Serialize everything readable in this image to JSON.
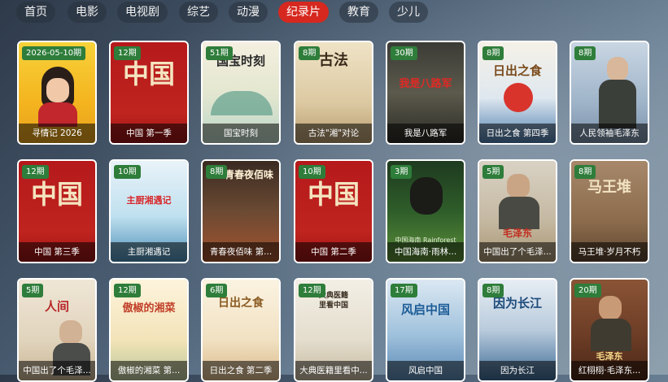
{
  "nav": {
    "tabs": [
      {
        "label": "首页"
      },
      {
        "label": "电影"
      },
      {
        "label": "电视剧"
      },
      {
        "label": "综艺"
      },
      {
        "label": "动漫"
      },
      {
        "label": "纪录片"
      },
      {
        "label": "教育"
      },
      {
        "label": "少儿"
      }
    ],
    "active_tab": "纪录片",
    "active_color": "#d6281f"
  },
  "cards": [
    {
      "badge": "2026-05-10期",
      "title": "寻情记 2026"
    },
    {
      "badge": "12期",
      "title": "中国 第一季",
      "art": "中国"
    },
    {
      "badge": "51期",
      "title": "国宝时刻",
      "art": "国宝时刻"
    },
    {
      "badge": "8期",
      "title": "古法\"湘\"对论",
      "art": "古法"
    },
    {
      "badge": "30期",
      "title": "我是八路军",
      "art": "我是八路军"
    },
    {
      "badge": "8期",
      "title": "日出之食 第四季",
      "art": "日出之食"
    },
    {
      "badge": "8期",
      "title": "人民领袖毛泽东"
    },
    {
      "badge": "12期",
      "title": "中国 第三季",
      "art": "中国"
    },
    {
      "badge": "10期",
      "title": "主厨湘遇记",
      "art": "主厨湘遇记"
    },
    {
      "badge": "8期",
      "title": "青春夜佰味 第...",
      "art": "青春夜佰味"
    },
    {
      "badge": "10期",
      "title": "中国 第二季",
      "art": "中国"
    },
    {
      "badge": "3期",
      "title": "中国海南·雨林...",
      "art": "中国海南 Rainforest"
    },
    {
      "badge": "5期",
      "title": "中国出了个毛泽...",
      "art": "毛泽东"
    },
    {
      "badge": "8期",
      "title": "马王堆·岁月不朽",
      "art": "马王堆"
    },
    {
      "badge": "5期",
      "title": "中国出了个毛泽...",
      "art": "人间"
    },
    {
      "badge": "12期",
      "title": "傲椒的湘菜 第...",
      "art": "傲椒的湘菜"
    },
    {
      "badge": "6期",
      "title": "日出之食 第二季",
      "art": "日出之食"
    },
    {
      "badge": "12期",
      "title": "大典医籍里看中...",
      "art": "大典医籍里看中国"
    },
    {
      "badge": "17期",
      "title": "风启中国",
      "art": "风启中国"
    },
    {
      "badge": "8期",
      "title": "因为长江",
      "art": "因为长江"
    },
    {
      "badge": "20期",
      "title": "红栩栩·毛泽东...",
      "art": "毛泽东"
    }
  ]
}
